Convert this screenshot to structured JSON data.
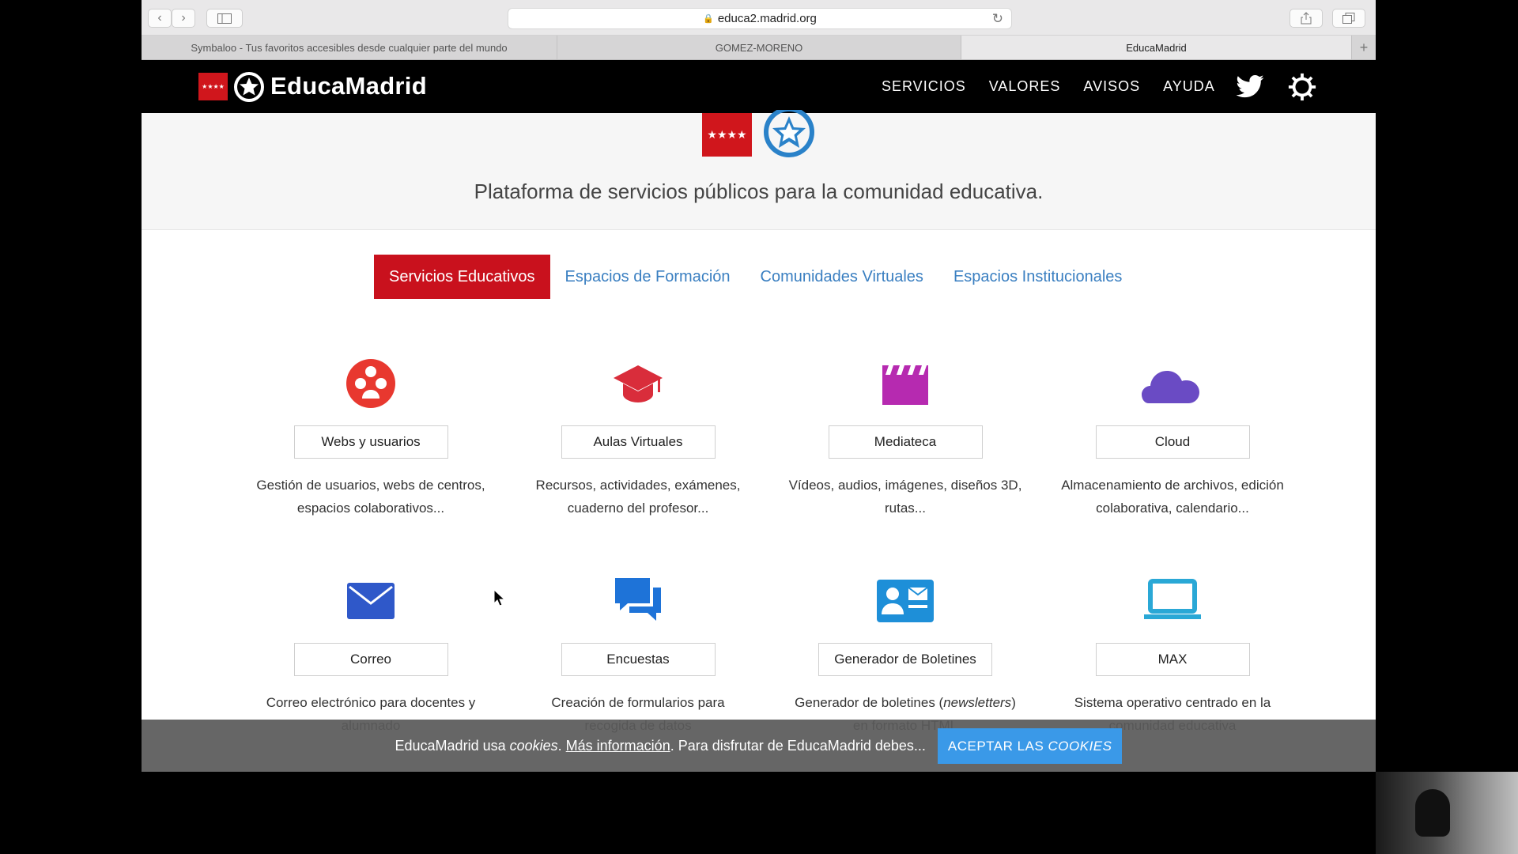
{
  "browser": {
    "url": "educa2.madrid.org",
    "tabs": [
      {
        "label": "Symbaloo - Tus favoritos accesibles desde cualquier parte del mundo",
        "active": false
      },
      {
        "label": "GOMEZ-MORENO",
        "active": false
      },
      {
        "label": "EducaMadrid",
        "active": true
      }
    ]
  },
  "site": {
    "brand": "EducaMadrid",
    "nav": [
      "SERVICIOS",
      "VALORES",
      "AVISOS",
      "AYUDA"
    ],
    "hero_tagline": "Plataforma de servicios públicos para la comunidad educativa.",
    "section_tabs": [
      "Servicios Educativos",
      "Espacios de Formación",
      "Comunidades Virtuales",
      "Espacios Institucionales"
    ],
    "active_tab": "Servicios Educativos"
  },
  "services": [
    {
      "name": "Webs y usuarios",
      "desc1": "Gestión de usuarios, webs de centros,",
      "desc2": "espacios colaborativos...",
      "icon": "users-circle-icon",
      "color": "#e8382f"
    },
    {
      "name": "Aulas Virtuales",
      "desc1": "Recursos, actividades, exámenes,",
      "desc2": "cuaderno del profesor...",
      "icon": "graduation-cap-icon",
      "color": "#d92d3b"
    },
    {
      "name": "Mediateca",
      "desc1": "Vídeos, audios, imágenes, diseños 3D,",
      "desc2": "rutas...",
      "icon": "clapperboard-icon",
      "color": "#b62ab0"
    },
    {
      "name": "Cloud",
      "desc1": "Almacenamiento de archivos, edición",
      "desc2": "colaborativa, calendario...",
      "icon": "cloud-icon",
      "color": "#6a4bc4"
    },
    {
      "name": "Correo",
      "desc1": "Correo electrónico para docentes y",
      "desc2": "alumnado",
      "icon": "envelope-icon",
      "color": "#2f58c9"
    },
    {
      "name": "Encuestas",
      "desc1": "Creación de formularios para",
      "desc2": "recogida de datos",
      "icon": "chat-bubbles-icon",
      "color": "#1e73d8"
    },
    {
      "name": "Generador de Boletines",
      "desc1_prefix": "Generador de boletines (",
      "desc1_em": "newsletters",
      "desc1_suffix": ")",
      "desc2": "en formato HTML",
      "icon": "id-card-icon",
      "color": "#1e8fd8"
    },
    {
      "name": "MAX",
      "desc1": "Sistema operativo centrado en la",
      "desc2": "comunidad educativa",
      "icon": "laptop-icon",
      "color": "#2aa8d6"
    }
  ],
  "cookie": {
    "text_prefix": "EducaMadrid usa ",
    "text_em": "cookies",
    "text_mid": ". ",
    "link": "Más información",
    "text_suffix": ". Para disfrutar de EducaMadrid debes...",
    "button_prefix": "ACEPTAR LAS ",
    "button_em": "COOKIES"
  },
  "colors": {
    "brand_red": "#c9111d",
    "link_blue": "#3a7fc1",
    "cookie_button": "#3a99e8"
  }
}
